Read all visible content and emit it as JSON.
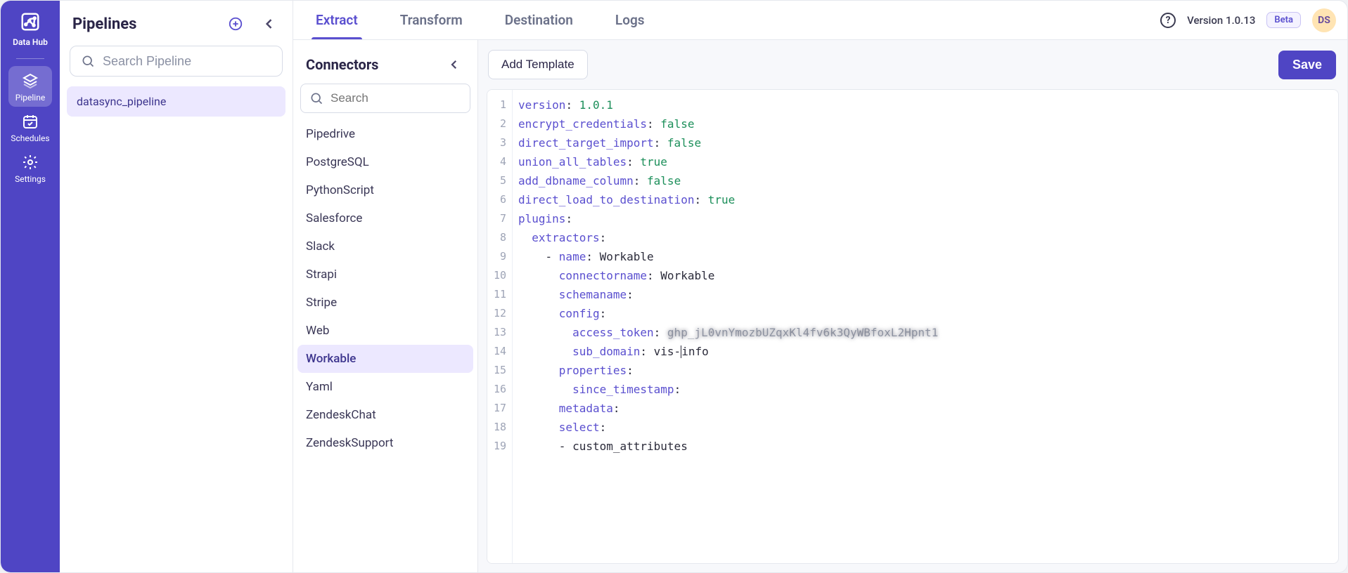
{
  "app": {
    "name": "Data Hub"
  },
  "rail": {
    "logo_label": "Data Hub",
    "items": [
      {
        "label": "Pipeline",
        "icon": "layers-icon",
        "active": true
      },
      {
        "label": "Schedules",
        "icon": "calendar-icon",
        "active": false
      },
      {
        "label": "Settings",
        "icon": "gear-icon",
        "active": false
      }
    ]
  },
  "pipelines": {
    "title": "Pipelines",
    "search_placeholder": "Search Pipeline",
    "items": [
      {
        "name": "datasync_pipeline",
        "active": true
      }
    ]
  },
  "tabs": {
    "items": [
      {
        "label": "Extract",
        "active": true
      },
      {
        "label": "Transform",
        "active": false
      },
      {
        "label": "Destination",
        "active": false
      },
      {
        "label": "Logs",
        "active": false
      }
    ]
  },
  "header_right": {
    "help_tooltip": "Help",
    "version": "Version 1.0.13",
    "beta_label": "Beta",
    "avatar_initials": "DS"
  },
  "connectors": {
    "title": "Connectors",
    "search_placeholder": "Search",
    "items": [
      {
        "label": "Pipedrive"
      },
      {
        "label": "PostgreSQL"
      },
      {
        "label": "PythonScript"
      },
      {
        "label": "Salesforce"
      },
      {
        "label": "Slack"
      },
      {
        "label": "Strapi"
      },
      {
        "label": "Stripe"
      },
      {
        "label": "Web"
      },
      {
        "label": "Workable",
        "active": true
      },
      {
        "label": "Yaml"
      },
      {
        "label": "ZendeskChat"
      },
      {
        "label": "ZendeskSupport"
      }
    ]
  },
  "editor_actions": {
    "add_template": "Add Template",
    "save": "Save"
  },
  "code": {
    "lines": [
      {
        "n": 1,
        "segments": [
          [
            "key",
            "version"
          ],
          [
            "plain",
            ": "
          ],
          [
            "str",
            "1.0.1"
          ]
        ]
      },
      {
        "n": 2,
        "segments": [
          [
            "key",
            "encrypt_credentials"
          ],
          [
            "plain",
            ": "
          ],
          [
            "str",
            "false"
          ]
        ]
      },
      {
        "n": 3,
        "segments": [
          [
            "key",
            "direct_target_import"
          ],
          [
            "plain",
            ": "
          ],
          [
            "str",
            "false"
          ]
        ]
      },
      {
        "n": 4,
        "segments": [
          [
            "key",
            "union_all_tables"
          ],
          [
            "plain",
            ": "
          ],
          [
            "str",
            "true"
          ]
        ]
      },
      {
        "n": 5,
        "segments": [
          [
            "key",
            "add_dbname_column"
          ],
          [
            "plain",
            ": "
          ],
          [
            "str",
            "false"
          ]
        ]
      },
      {
        "n": 6,
        "segments": [
          [
            "key",
            "direct_load_to_destination"
          ],
          [
            "plain",
            ": "
          ],
          [
            "str",
            "true"
          ]
        ]
      },
      {
        "n": 7,
        "segments": [
          [
            "key",
            "plugins"
          ],
          [
            "plain",
            ":"
          ]
        ]
      },
      {
        "n": 8,
        "segments": [
          [
            "plain",
            "  "
          ],
          [
            "key",
            "extractors"
          ],
          [
            "plain",
            ":"
          ]
        ]
      },
      {
        "n": 9,
        "segments": [
          [
            "plain",
            "    "
          ],
          [
            "dash",
            "- "
          ],
          [
            "key",
            "name"
          ],
          [
            "plain",
            ": Workable"
          ]
        ]
      },
      {
        "n": 10,
        "segments": [
          [
            "plain",
            "      "
          ],
          [
            "key",
            "connectorname"
          ],
          [
            "plain",
            ": Workable"
          ]
        ]
      },
      {
        "n": 11,
        "segments": [
          [
            "plain",
            "      "
          ],
          [
            "key",
            "schemaname"
          ],
          [
            "plain",
            ":"
          ]
        ]
      },
      {
        "n": 12,
        "segments": [
          [
            "plain",
            "      "
          ],
          [
            "key",
            "config"
          ],
          [
            "plain",
            ":"
          ]
        ]
      },
      {
        "n": 13,
        "segments": [
          [
            "plain",
            "        "
          ],
          [
            "key",
            "access_token"
          ],
          [
            "plain",
            ": "
          ],
          [
            "blur",
            "ghp_jL0vnYmozbUZqxKl4fv6k3QyWBfoxL2Hpnt1"
          ]
        ]
      },
      {
        "n": 14,
        "segments": [
          [
            "plain",
            "        "
          ],
          [
            "key",
            "sub_domain"
          ],
          [
            "plain",
            ": vis-"
          ],
          [
            "caret",
            ""
          ],
          [
            "plain",
            "info"
          ]
        ]
      },
      {
        "n": 15,
        "segments": [
          [
            "plain",
            "      "
          ],
          [
            "key",
            "properties"
          ],
          [
            "plain",
            ":"
          ]
        ]
      },
      {
        "n": 16,
        "segments": [
          [
            "plain",
            "        "
          ],
          [
            "key",
            "since_timestamp"
          ],
          [
            "plain",
            ":"
          ]
        ]
      },
      {
        "n": 17,
        "segments": [
          [
            "plain",
            "      "
          ],
          [
            "key",
            "metadata"
          ],
          [
            "plain",
            ":"
          ]
        ]
      },
      {
        "n": 18,
        "segments": [
          [
            "plain",
            "      "
          ],
          [
            "key",
            "select"
          ],
          [
            "plain",
            ":"
          ]
        ]
      },
      {
        "n": 19,
        "segments": [
          [
            "plain",
            "      - custom_attributes"
          ]
        ]
      }
    ]
  }
}
